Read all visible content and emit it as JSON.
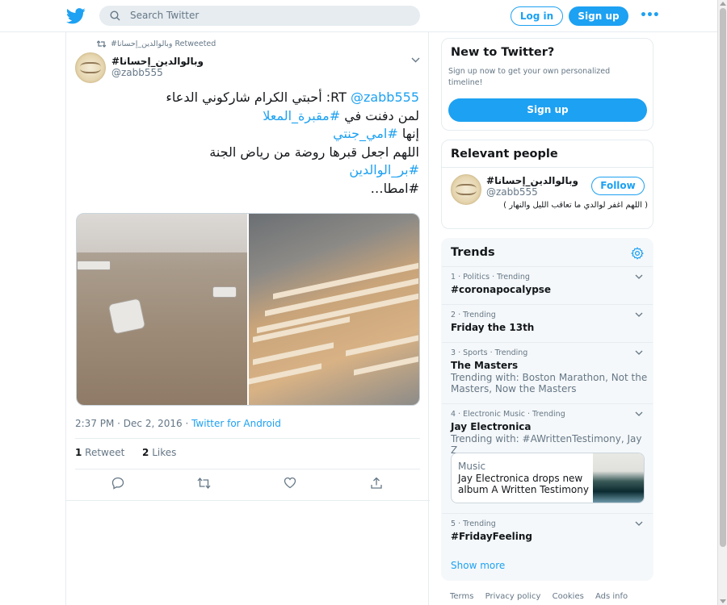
{
  "search": {
    "placeholder": "Search Twitter"
  },
  "header": {
    "login_label": "Log in",
    "signup_label": "Sign up",
    "more_label": "•••"
  },
  "tweet": {
    "retweeted_by": "#وبالوالدين_إحسانا Retweeted",
    "author_name": "#وبالوالدين_إحسانا",
    "author_handle": "@zabb555",
    "lines": [
      {
        "parts": [
          {
            "text": "RT ",
            "link": false
          },
          {
            "text": "@zabb555",
            "link": true
          },
          {
            "text": ": أحبتي  الكرام شاركوني الدعاء",
            "link": false
          }
        ]
      },
      {
        "parts": [
          {
            "text": "لمن دفنت في ",
            "link": false
          },
          {
            "text": "#مقبرة_المعلا",
            "link": true
          }
        ]
      },
      {
        "parts": [
          {
            "text": "إنها ",
            "link": false
          },
          {
            "text": "#امي_جنتي",
            "link": true
          }
        ]
      },
      {
        "parts": [
          {
            "text": "اللهم اجعل قبرها روضة من رياض الجنة",
            "link": false
          }
        ]
      },
      {
        "parts": [
          {
            "text": "#بر_الوالدين",
            "link": true
          }
        ]
      },
      {
        "parts": [
          {
            "text": "#امطا…",
            "link": false
          }
        ]
      }
    ],
    "timestamp": "2:37 PM · Dec 2, 2016 · ",
    "source": "Twitter for Android",
    "retweets_count": "1",
    "retweets_label": " Retweet",
    "likes_count": "2",
    "likes_label": " Likes"
  },
  "new_to_twitter": {
    "title": "New to Twitter?",
    "subtitle": "Sign up now to get your own personalized timeline!",
    "signup_label": "Sign up"
  },
  "relevant_people": {
    "title": "Relevant people",
    "name": "#وبالوالدين_إحسانا",
    "handle": "@zabb555",
    "follow_label": "Follow",
    "bio": "( اللهم اغفر لوالدي ما تعاقب الليل والنهار )"
  },
  "trends": {
    "title": "Trends",
    "items": [
      {
        "meta": "1 · Politics · Trending",
        "name": "#coronapocalypse",
        "with": ""
      },
      {
        "meta": "2 · Trending",
        "name": "Friday the 13th",
        "with": ""
      },
      {
        "meta": "3 · Sports · Trending",
        "name": "The Masters",
        "with": "Trending with: Boston Marathon, Not the Masters, Now the Masters"
      },
      {
        "meta": "4 · Electronic Music · Trending",
        "name": "Jay Electronica",
        "with": "Trending with: #AWrittenTestimony, Jay Z"
      },
      {
        "meta": "5 · Trending",
        "name": "#FridayFeeling",
        "with": ""
      }
    ],
    "music_card": {
      "category": "Music",
      "title": "Jay Electronica drops new album A Written Testimony"
    },
    "show_more": "Show more"
  },
  "footer": {
    "links": [
      "Terms",
      "Privacy policy",
      "Cookies",
      "Ads info"
    ]
  },
  "colors": {
    "accent": "#1da1f2",
    "text": "#14171a",
    "muted": "#657786",
    "border": "#e6ecf0"
  }
}
